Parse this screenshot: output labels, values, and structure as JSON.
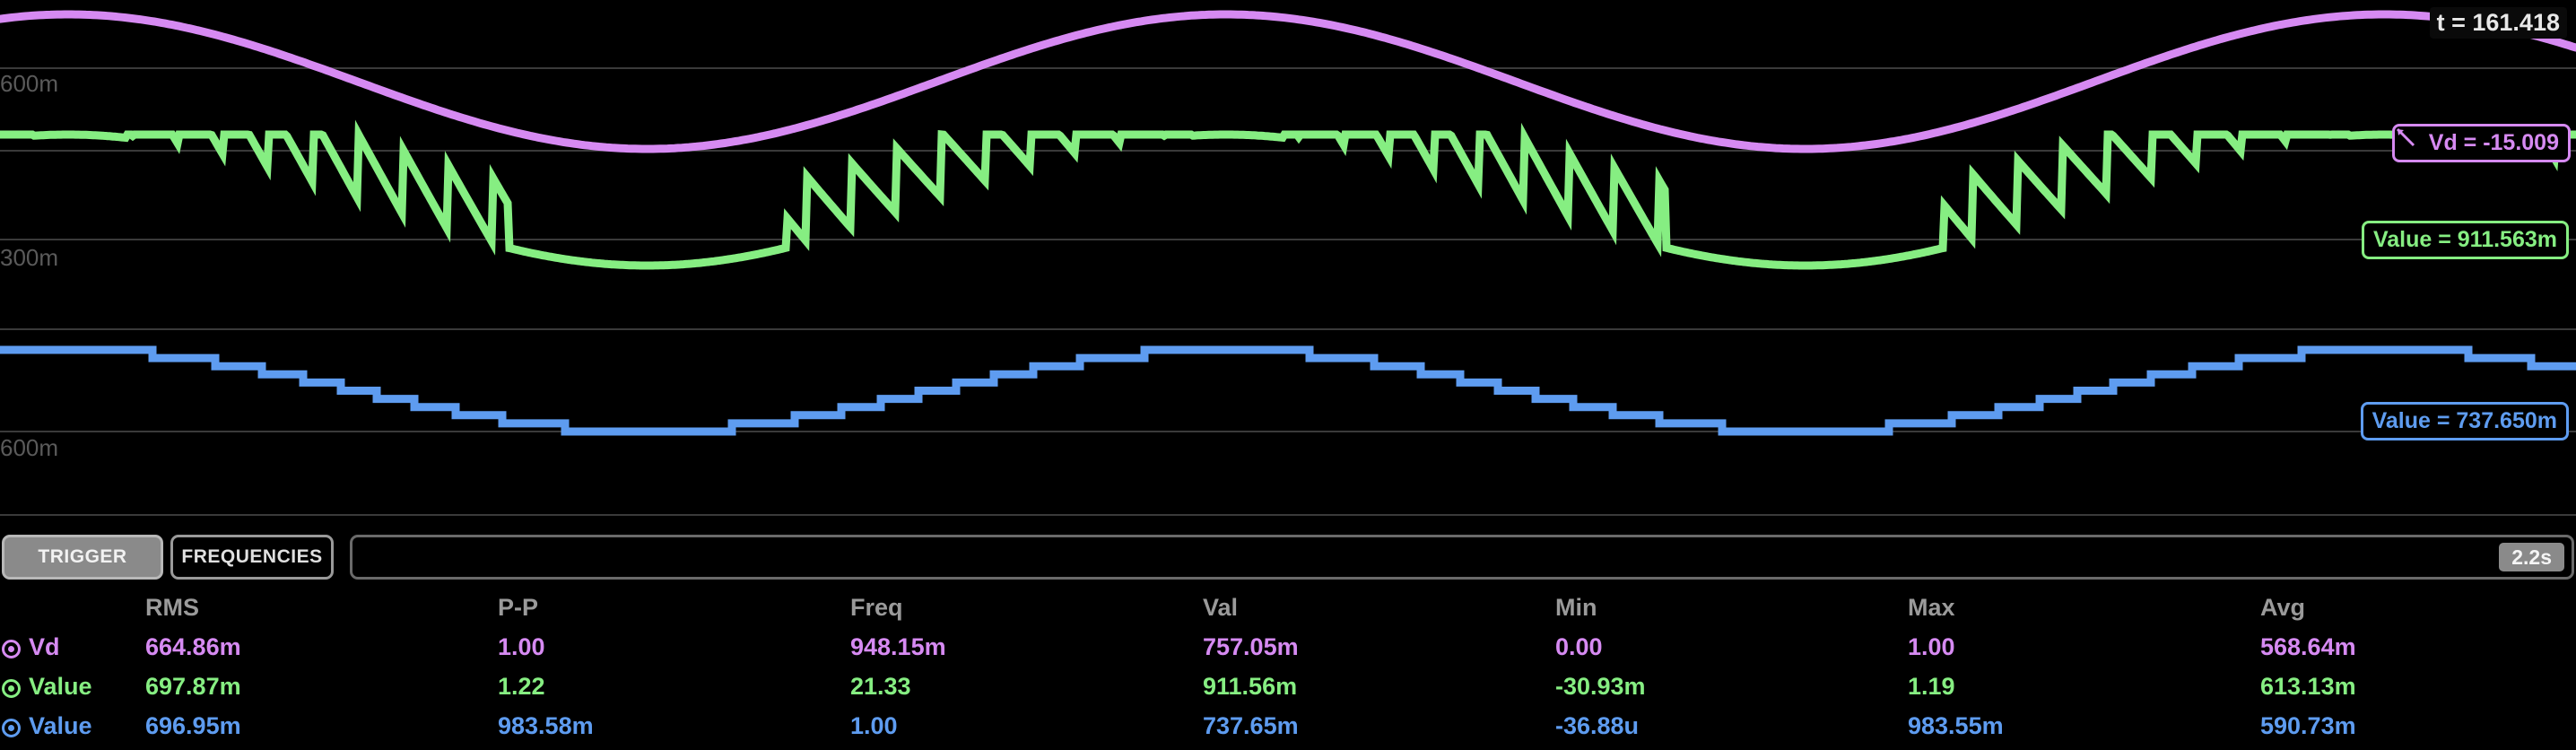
{
  "time_readout": "t = 161.418",
  "axis_labels": [
    "600m",
    "300m",
    "600m"
  ],
  "traces": [
    {
      "name": "Vd",
      "color": "#d68af2",
      "readout": "Vd = -15.009",
      "readout_icon": "probe-icon"
    },
    {
      "name": "Value",
      "color": "#86ee82",
      "readout": "Value = 911.563m"
    },
    {
      "name": "Value",
      "color": "#5e9cf0",
      "readout": "Value = 737.650m"
    }
  ],
  "controls": {
    "trigger_label": "TRIGGER",
    "frequencies_label": "FREQUENCIES",
    "timebase": "2.2s"
  },
  "table": {
    "headers": [
      "RMS",
      "P-P",
      "Freq",
      "Val",
      "Min",
      "Max",
      "Avg"
    ],
    "rows": [
      {
        "name": "Vd",
        "color": "#d68af2",
        "values": [
          "664.86m",
          "1.00",
          "948.15m",
          "757.05m",
          "0.00",
          "1.00",
          "568.64m"
        ]
      },
      {
        "name": "Value",
        "color": "#86ee82",
        "values": [
          "697.87m",
          "1.22",
          "21.33",
          "911.56m",
          "-30.93m",
          "1.19",
          "613.13m"
        ]
      },
      {
        "name": "Value",
        "color": "#5e9cf0",
        "values": [
          "696.95m",
          "983.58m",
          "1.00",
          "737.65m",
          "-36.88u",
          "983.55m",
          "590.73m"
        ]
      }
    ]
  }
}
